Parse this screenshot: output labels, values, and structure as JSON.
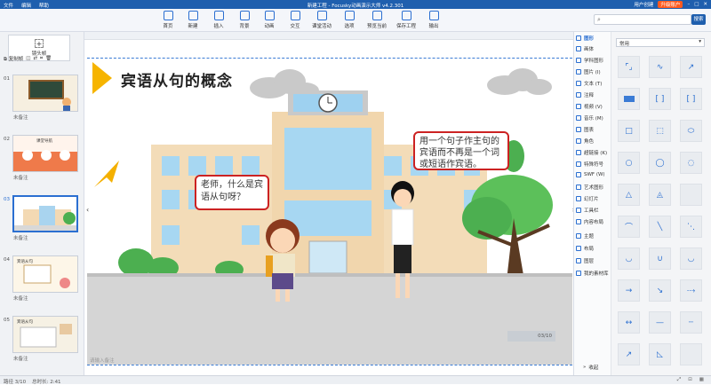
{
  "app": {
    "menu": [
      "文件",
      "编辑",
      "帮助"
    ],
    "title": "新建工程 - Focusky动画演示大师 v4.2.301",
    "user_center": "用户创建",
    "upgrade": "升级账户"
  },
  "toolbar": {
    "buttons": [
      {
        "label": "首页",
        "icon": "home-icon"
      },
      {
        "label": "新建",
        "icon": "new-icon"
      },
      {
        "label": "插入",
        "icon": "insert-icon"
      },
      {
        "label": "背景",
        "icon": "background-icon"
      },
      {
        "label": "动画",
        "icon": "animation-icon"
      },
      {
        "label": "交互",
        "icon": "interaction-icon"
      },
      {
        "label": "课堂活动",
        "icon": "class-activity-icon"
      },
      {
        "label": "选项",
        "icon": "options-icon"
      },
      {
        "label": "预览当前",
        "icon": "preview-icon"
      },
      {
        "label": "保存工程",
        "icon": "save-icon"
      },
      {
        "label": "输出",
        "icon": "export-icon"
      }
    ],
    "search_button": "搜索"
  },
  "left_panel": {
    "camera_frame": "镜头帧",
    "copy_frame": "复制帧",
    "slides": [
      {
        "num": "01",
        "note": "未备注",
        "thumb": "宾语从句"
      },
      {
        "num": "02",
        "note": "未备注",
        "thumb": "课堂导航"
      },
      {
        "num": "03",
        "note": "未备注",
        "thumb": ""
      },
      {
        "num": "04",
        "note": "未备注",
        "thumb": "宾语从句"
      },
      {
        "num": "05",
        "note": "未备注",
        "thumb": "宾语从句"
      }
    ]
  },
  "canvas": {
    "slide_title": "宾语从句的概念",
    "bubble_girl": "老师，什么是宾语从句呀？",
    "bubble_teacher": "用一个句子作主句的宾语而不再是一个词或短语作宾语。",
    "pager": "03/10",
    "notes_placeholder": "请输入备注"
  },
  "right_panel": {
    "categories": [
      "图形",
      "画体",
      "学科图形",
      "图片 (I)",
      "文本 (T)",
      "注释",
      "视频 (V)",
      "音乐 (M)",
      "图表",
      "角色",
      "超链接 (K)",
      "特殊符号",
      "SWF (W)",
      "艺术图形",
      "幻灯片",
      "工具栏",
      "内容布局",
      "主题",
      "布局",
      "图层",
      "我的素材库"
    ],
    "dropdown": "常用",
    "collapse": "收起"
  },
  "status": {
    "path": "路径 3/10",
    "duration": "总时长: 2:41"
  },
  "colors": {
    "accent": "#2b6fd1",
    "title_bar": "#1f5fae",
    "bubble_border": "#cc2222"
  }
}
